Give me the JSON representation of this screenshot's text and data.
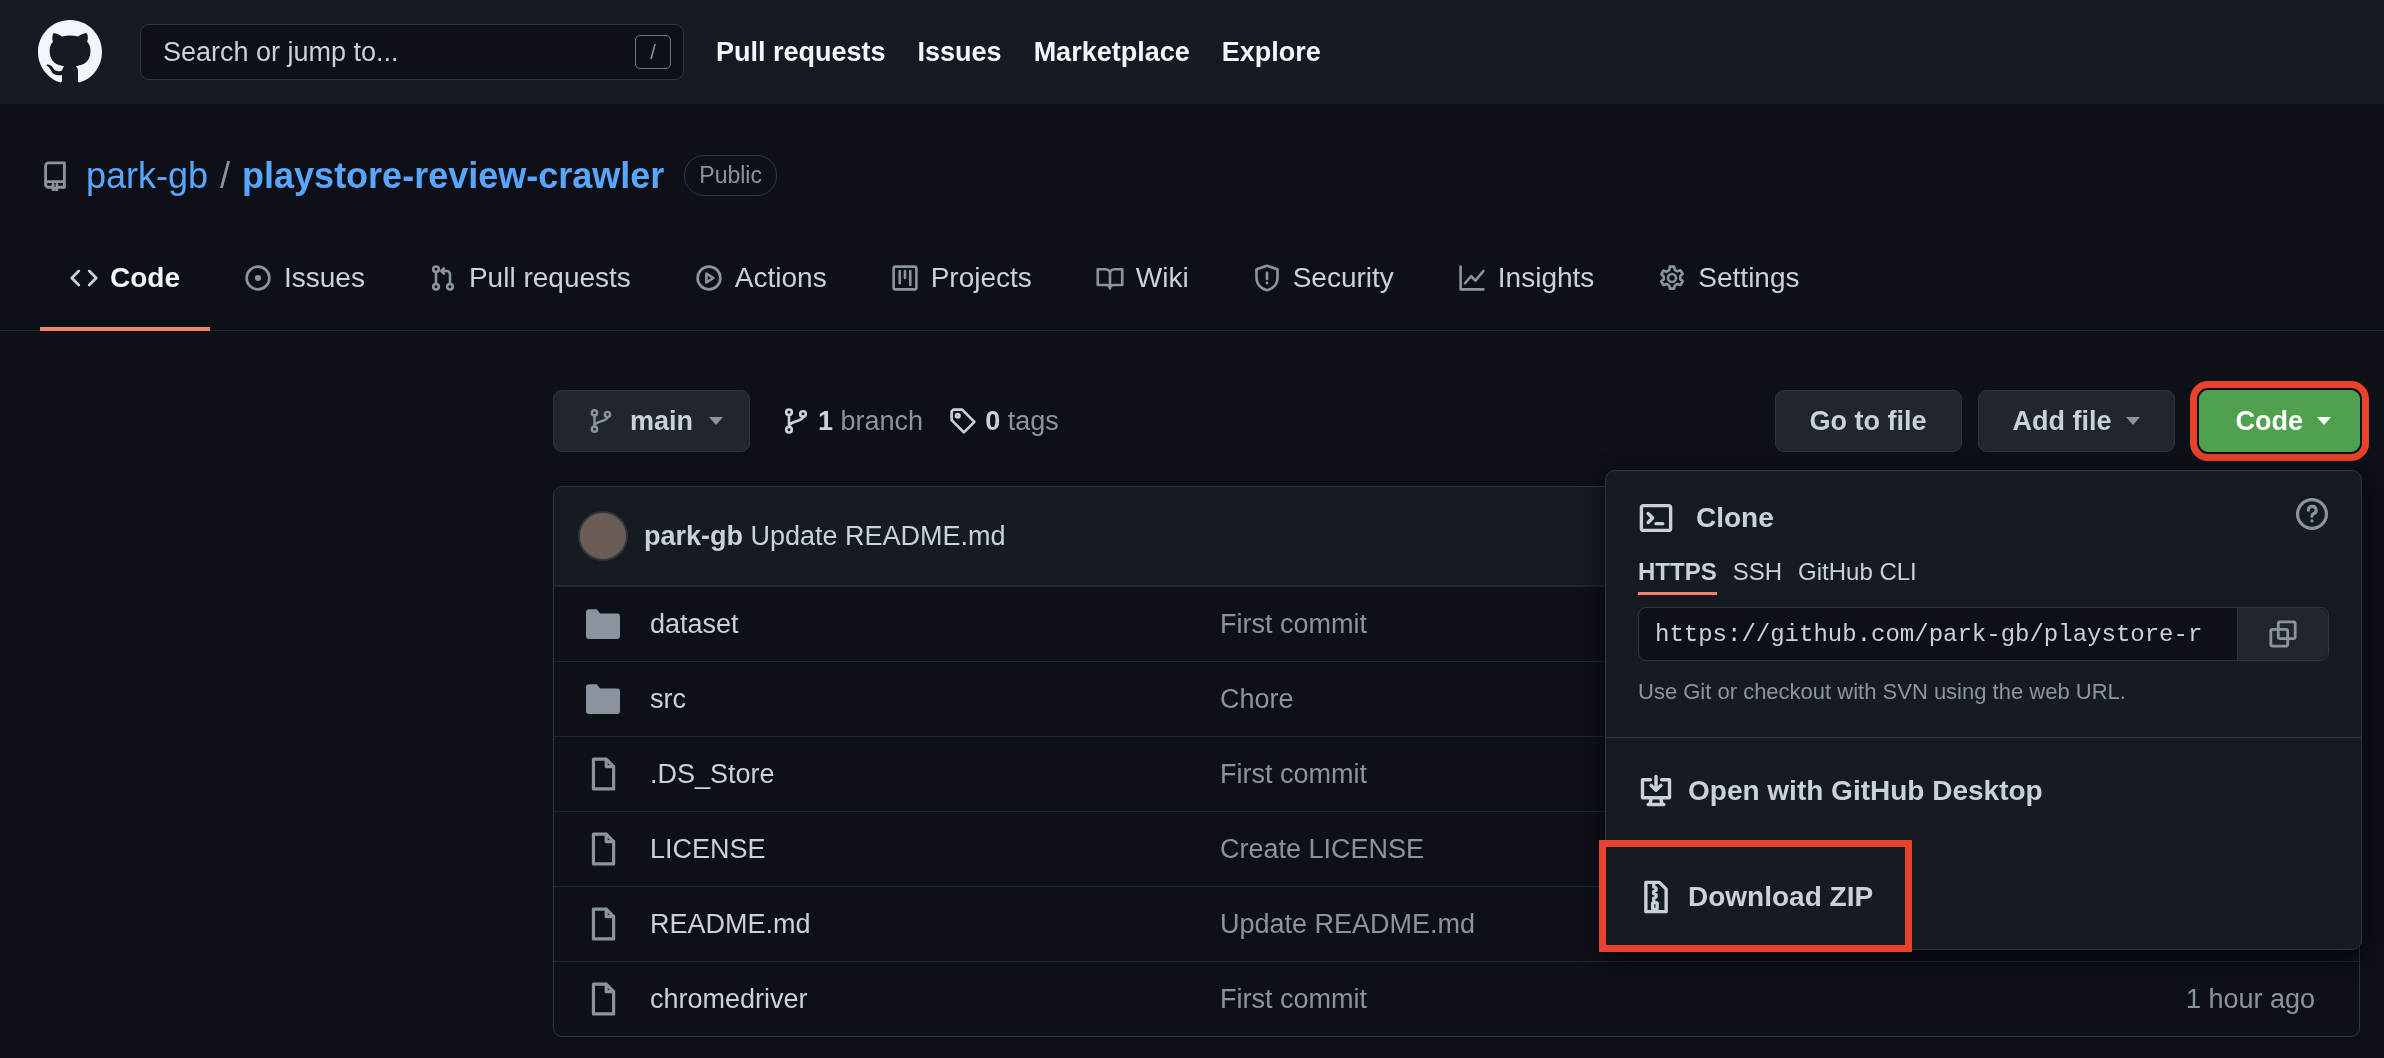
{
  "header": {
    "search": {
      "placeholder": "Search or jump to...",
      "shortcut": "/"
    },
    "nav": [
      "Pull requests",
      "Issues",
      "Marketplace",
      "Explore"
    ]
  },
  "repo": {
    "owner": "park-gb",
    "separator": "/",
    "name": "playstore-review-crawler",
    "visibility": "Public"
  },
  "tabs": [
    {
      "label": "Code",
      "kind": "code",
      "selected": true
    },
    {
      "label": "Issues",
      "kind": "issue",
      "selected": false
    },
    {
      "label": "Pull requests",
      "kind": "pull",
      "selected": false
    },
    {
      "label": "Actions",
      "kind": "play",
      "selected": false
    },
    {
      "label": "Projects",
      "kind": "project",
      "selected": false
    },
    {
      "label": "Wiki",
      "kind": "book",
      "selected": false
    },
    {
      "label": "Security",
      "kind": "shield",
      "selected": false
    },
    {
      "label": "Insights",
      "kind": "graph",
      "selected": false
    },
    {
      "label": "Settings",
      "kind": "gear",
      "selected": false
    }
  ],
  "toolbar": {
    "branch": "main",
    "branch_count": "1",
    "branch_label": "branch",
    "tag_count": "0",
    "tag_label": "tags",
    "buttons": [
      {
        "label": "Go to file",
        "kind": "plain",
        "highlighted": false
      },
      {
        "label": "Add file",
        "kind": "dropdown",
        "highlighted": false
      },
      {
        "label": "Code",
        "kind": "primary",
        "highlighted": true
      }
    ]
  },
  "commit": {
    "author": "park-gb",
    "message": "Update README.md"
  },
  "files": [
    {
      "kind": "folder",
      "name": "dataset",
      "message": "First commit"
    },
    {
      "kind": "folder",
      "name": "src",
      "message": "Chore"
    },
    {
      "kind": "file",
      "name": ".DS_Store",
      "message": "First commit"
    },
    {
      "kind": "file",
      "name": "LICENSE",
      "message": "Create LICENSE"
    },
    {
      "kind": "file",
      "name": "README.md",
      "message": "Update README.md"
    },
    {
      "kind": "file",
      "name": "chromedriver",
      "message": "First commit",
      "age": "1 hour ago"
    }
  ],
  "clone_menu": {
    "title": "Clone",
    "protocols": [
      {
        "label": "HTTPS",
        "selected": true
      },
      {
        "label": "SSH",
        "selected": false
      },
      {
        "label": "GitHub CLI",
        "selected": false
      }
    ],
    "url": "https://github.com/park-gb/playstore-r",
    "hint": "Use Git or checkout with SVN using the web URL.",
    "actions": [
      {
        "label": "Open with GitHub Desktop",
        "kind": "desktop",
        "highlighted": false
      },
      {
        "label": "Download ZIP",
        "kind": "zip",
        "highlighted": true
      }
    ]
  }
}
